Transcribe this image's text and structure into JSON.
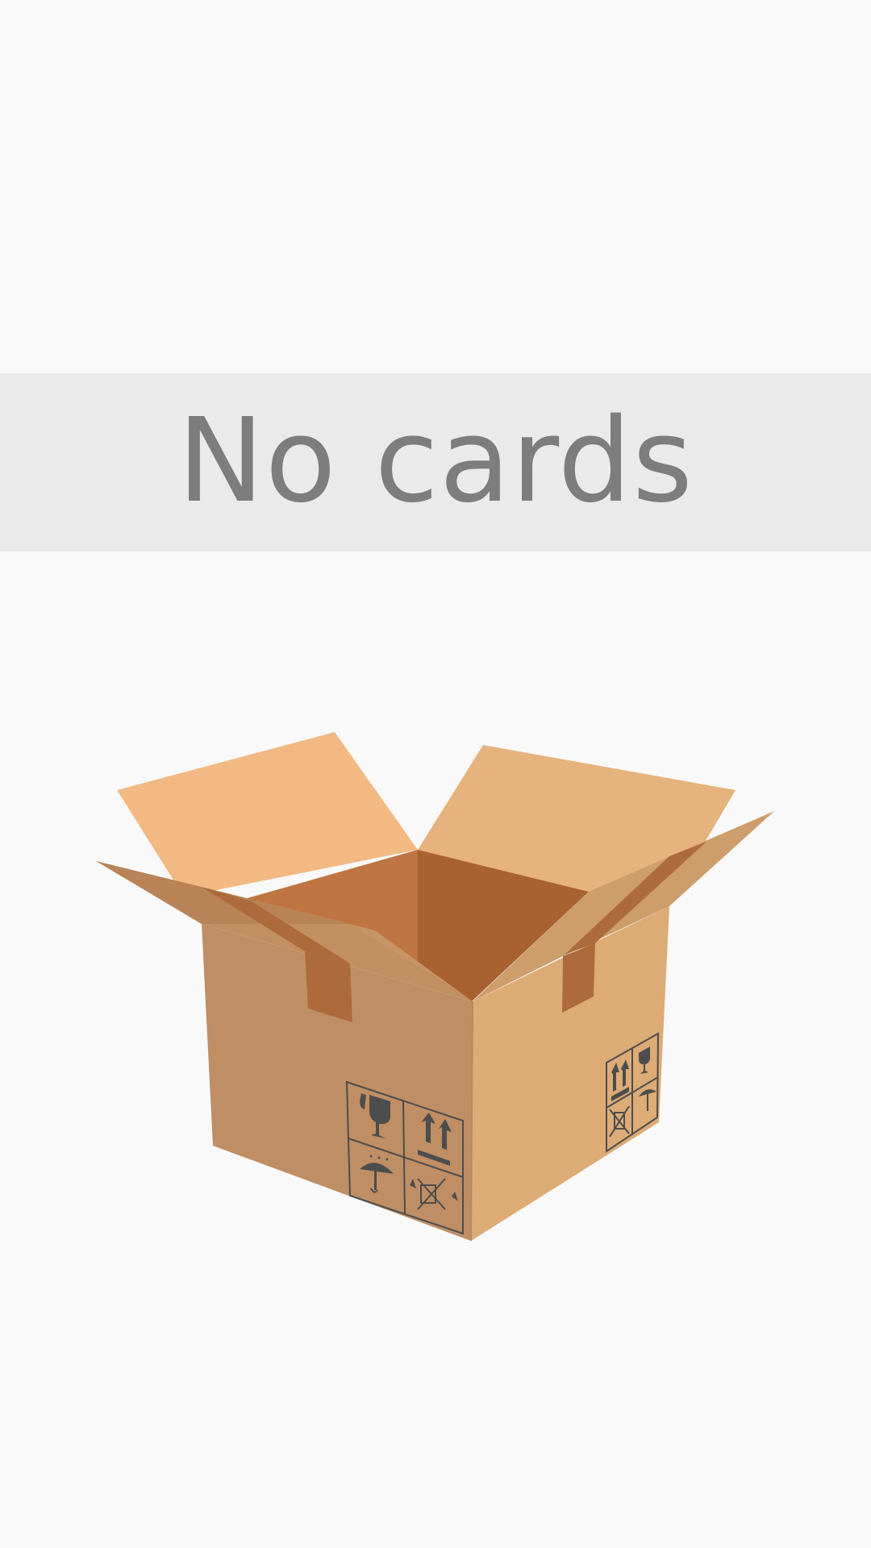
{
  "empty_state": {
    "message": "No cards"
  },
  "illustration": {
    "name": "open-cardboard-box",
    "icons": [
      "fragile-glass-icon",
      "this-side-up-icon",
      "keep-dry-icon",
      "do-not-stack-icon"
    ],
    "colors": {
      "flap_back_left": "#f2b983",
      "flap_back_right": "#e6b27d",
      "inner_left": "#be7541",
      "inner_right": "#a96132",
      "front_face": "#bf8e64",
      "side_face": "#dcab76",
      "flap_front": "#c29062",
      "tape": "#ad6b3d",
      "symbols": "#4d4d4d",
      "background": "#f9f9f9",
      "banner": "#eaeaea",
      "text": "#7d7d7d"
    }
  }
}
